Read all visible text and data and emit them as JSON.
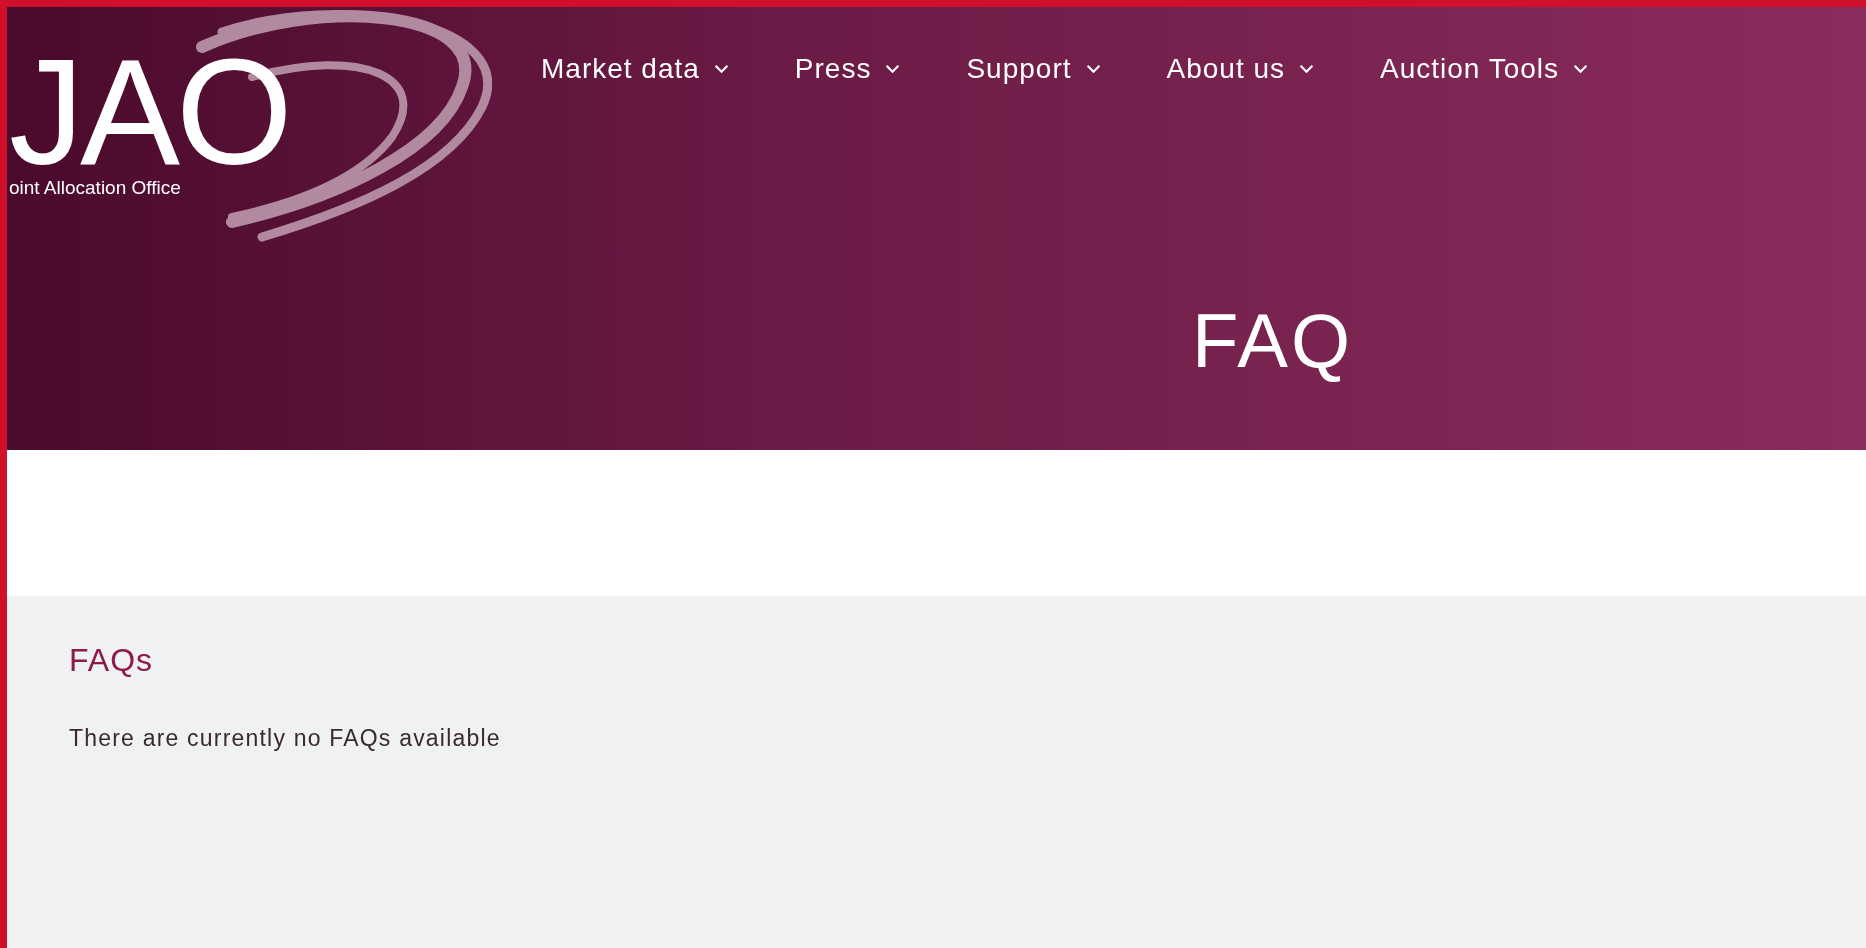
{
  "logo": {
    "letters": "JAO",
    "tagline": "oint Allocation Office"
  },
  "nav": [
    {
      "label": "Market data",
      "caret": true
    },
    {
      "label": "Press",
      "caret": true
    },
    {
      "label": "Support",
      "caret": true
    },
    {
      "label": "About us",
      "caret": true
    },
    {
      "label": "Auction Tools",
      "caret": true
    }
  ],
  "hero": {
    "title": "FAQ"
  },
  "content": {
    "heading": "FAQs",
    "message": "There are currently no FAQs available"
  }
}
